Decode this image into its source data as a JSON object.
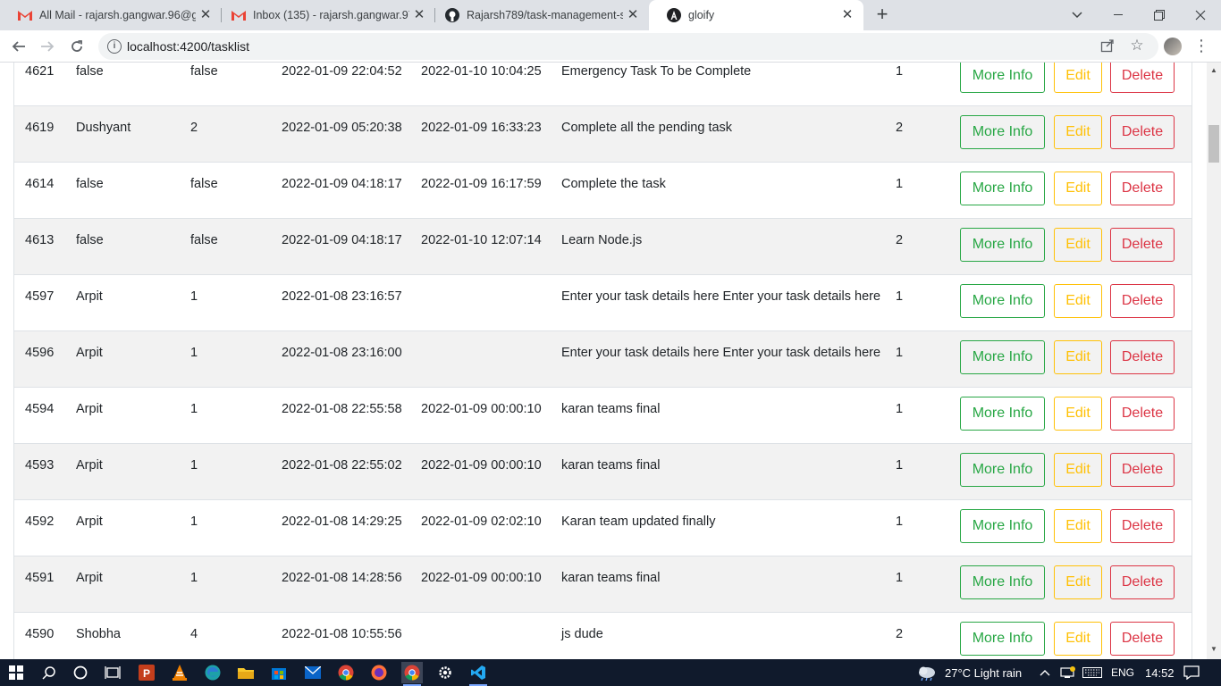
{
  "browser": {
    "tabs": [
      {
        "title": "All Mail - rajarsh.gangwar.96@gm",
        "favicon": "gmail-icon",
        "active": false
      },
      {
        "title": "Inbox (135) - rajarsh.gangwar.97@",
        "favicon": "gmail-icon",
        "active": false
      },
      {
        "title": "Rajarsh789/task-management-sy",
        "favicon": "github-icon",
        "active": false
      },
      {
        "title": "gloify",
        "favicon": "angular-icon",
        "active": true
      }
    ],
    "url": "localhost:4200/tasklist"
  },
  "table": {
    "buttons": {
      "info": "More Info",
      "edit": "Edit",
      "delete": "Delete"
    },
    "rows": [
      {
        "id": "4621",
        "name": "false",
        "value": "false",
        "start": "2022-01-09 22:04:52",
        "end": "2022-01-10 10:04:25",
        "description": "Emergency Task To be Complete",
        "priority": "1"
      },
      {
        "id": "4619",
        "name": "Dushyant",
        "value": "2",
        "start": "2022-01-09 05:20:38",
        "end": "2022-01-09 16:33:23",
        "description": "Complete all the pending task",
        "priority": "2"
      },
      {
        "id": "4614",
        "name": "false",
        "value": "false",
        "start": "2022-01-09 04:18:17",
        "end": "2022-01-09 16:17:59",
        "description": "Complete the task",
        "priority": "1"
      },
      {
        "id": "4613",
        "name": "false",
        "value": "false",
        "start": "2022-01-09 04:18:17",
        "end": "2022-01-10 12:07:14",
        "description": "Learn Node.js",
        "priority": "2"
      },
      {
        "id": "4597",
        "name": "Arpit",
        "value": "1",
        "start": "2022-01-08 23:16:57",
        "end": "",
        "description": "Enter your task details here Enter your task details here",
        "priority": "1"
      },
      {
        "id": "4596",
        "name": "Arpit",
        "value": "1",
        "start": "2022-01-08 23:16:00",
        "end": "",
        "description": "Enter your task details here Enter your task details here",
        "priority": "1"
      },
      {
        "id": "4594",
        "name": "Arpit",
        "value": "1",
        "start": "2022-01-08 22:55:58",
        "end": "2022-01-09 00:00:10",
        "description": "karan teams final",
        "priority": "1"
      },
      {
        "id": "4593",
        "name": "Arpit",
        "value": "1",
        "start": "2022-01-08 22:55:02",
        "end": "2022-01-09 00:00:10",
        "description": "karan teams final",
        "priority": "1"
      },
      {
        "id": "4592",
        "name": "Arpit",
        "value": "1",
        "start": "2022-01-08 14:29:25",
        "end": "2022-01-09 02:02:10",
        "description": "Karan team updated finally",
        "priority": "1"
      },
      {
        "id": "4591",
        "name": "Arpit",
        "value": "1",
        "start": "2022-01-08 14:28:56",
        "end": "2022-01-09 00:00:10",
        "description": "karan teams final",
        "priority": "1"
      },
      {
        "id": "4590",
        "name": "Shobha",
        "value": "4",
        "start": "2022-01-08 10:55:56",
        "end": "",
        "description": "js dude",
        "priority": "2"
      }
    ]
  },
  "taskbar": {
    "weather": "27°C  Light rain",
    "language": "ENG",
    "time": "14:52"
  },
  "colors": {
    "info": "#28a745",
    "edit": "#ffc107",
    "delete": "#dc3545",
    "stripe": "#f2f2f2"
  }
}
